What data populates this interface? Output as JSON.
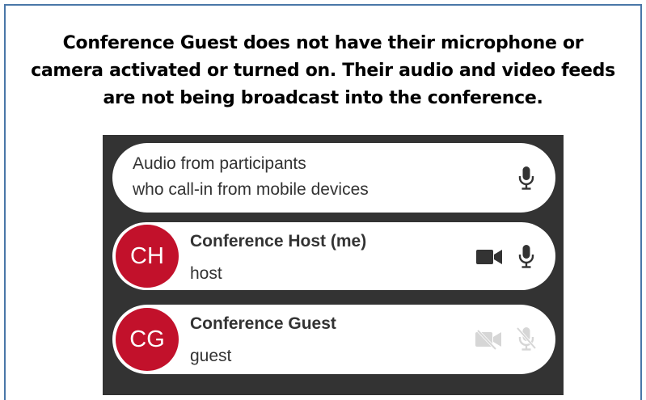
{
  "caption": "Conference Guest does not have their microphone or camera activated or turned on. Their audio and video feeds are not being broadcast into the conference.",
  "audio_row": {
    "line1": "Audio from participants",
    "line2": "who call-in from mobile devices",
    "mic_icon": "microphone-icon"
  },
  "participants": [
    {
      "initials": "CH",
      "name": "Conference Host (me)",
      "role": "host",
      "camera": "on",
      "microphone": "on"
    },
    {
      "initials": "CG",
      "name": "Conference Guest",
      "role": "guest",
      "camera": "off",
      "microphone": "off"
    }
  ],
  "colors": {
    "avatar": "#c2112b",
    "panel": "#333333",
    "frame": "#4a77a8",
    "icon_active": "#333333",
    "icon_inactive": "#d6d6d6"
  }
}
